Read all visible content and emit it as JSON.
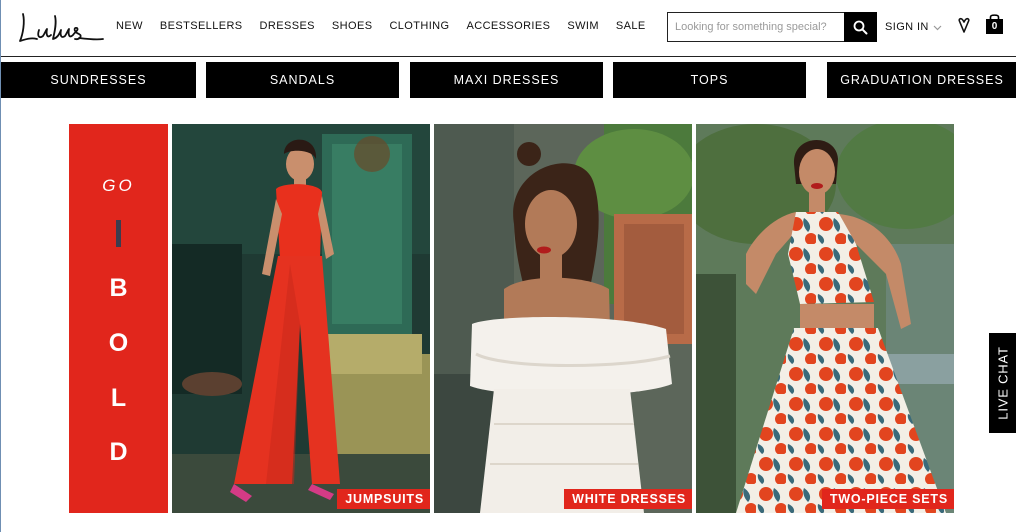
{
  "header": {
    "logo_text": "Lulus",
    "nav": [
      "NEW",
      "BESTSELLERS",
      "DRESSES",
      "SHOES",
      "CLOTHING",
      "ACCESSORIES",
      "SWIM",
      "SALE"
    ],
    "search_placeholder": "Looking for something special?",
    "sign_in": "SIGN IN",
    "bag_count": "0",
    "icons": [
      "search-icon",
      "chevron-down-icon",
      "heart-icon",
      "shopping-bag-icon"
    ]
  },
  "categories": [
    "SUNDRESSES",
    "SANDALS",
    "MAXI DRESSES",
    "TOPS",
    "GRADUATION DRESSES"
  ],
  "hero": {
    "go": "GO",
    "bold_letters": [
      "B",
      "O",
      "L",
      "D"
    ],
    "colors": {
      "accent_red": "#e1261c",
      "black": "#000000"
    },
    "panels": [
      {
        "label": "JUMPSUITS"
      },
      {
        "label": "WHITE DRESSES"
      },
      {
        "label": "TWO-PIECE SETS"
      }
    ]
  },
  "live_chat": "LIVE CHAT"
}
